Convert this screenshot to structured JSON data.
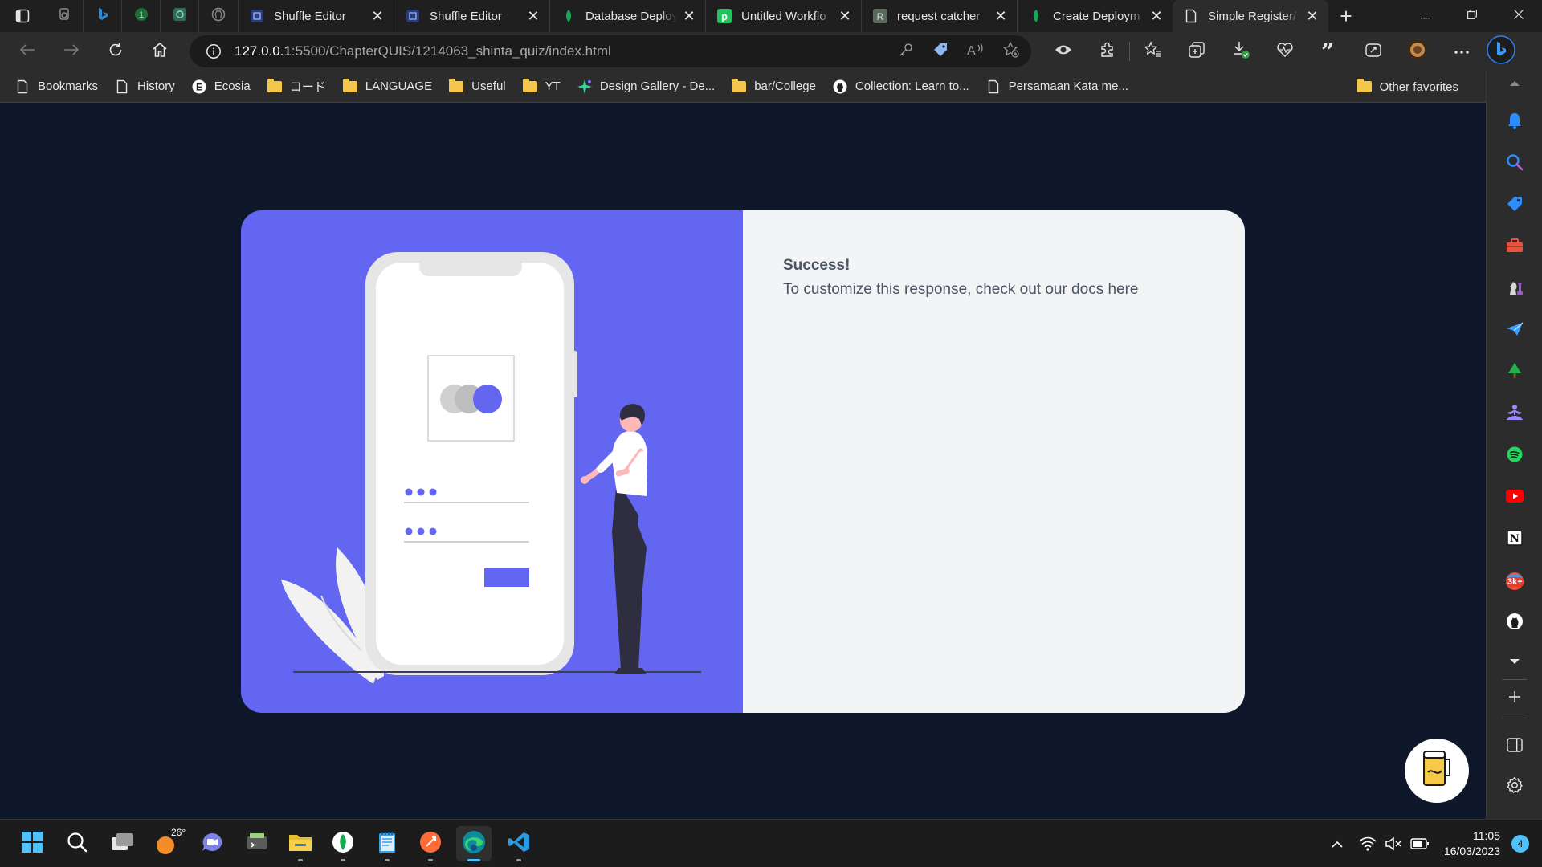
{
  "browser": {
    "tabs": [
      {
        "title": "Shuffle Editor",
        "icon": "shuffle-icon"
      },
      {
        "title": "Shuffle Editor",
        "icon": "shuffle-icon"
      },
      {
        "title": "Database Deploy",
        "icon": "mongodb-leaf-icon"
      },
      {
        "title": "Untitled Workflo",
        "icon": "pipedream-icon"
      },
      {
        "title": "request catcher",
        "icon": "r-icon"
      },
      {
        "title": "Create Deploym",
        "icon": "mongodb-leaf-icon"
      },
      {
        "title": "Simple Register/",
        "icon": "page-icon",
        "active": true
      }
    ],
    "url": {
      "host": "127.0.0.1",
      "path": ":5500/ChapterQUIS/1214063_shinta_quiz/index.html"
    }
  },
  "bookmarks": {
    "items": [
      {
        "label": "Bookmarks",
        "icon": "bookmarks-icon"
      },
      {
        "label": "History",
        "icon": "page-icon"
      },
      {
        "label": "Ecosia",
        "icon": "ecosia-icon"
      },
      {
        "label": "コード",
        "icon": "folder-icon"
      },
      {
        "label": "LANGUAGE",
        "icon": "folder-icon"
      },
      {
        "label": "Useful",
        "icon": "folder-icon"
      },
      {
        "label": "YT",
        "icon": "folder-icon"
      },
      {
        "label": "Design Gallery - De...",
        "icon": "sparkle-icon"
      },
      {
        "label": "bar/College",
        "icon": "folder-icon"
      },
      {
        "label": "Collection: Learn to...",
        "icon": "github-icon"
      },
      {
        "label": "Persamaan Kata me...",
        "icon": "page-icon"
      }
    ],
    "other": "Other favorites"
  },
  "page": {
    "message_title": "Success!",
    "message_body": "To customize this response, check out our docs here"
  },
  "taskbar": {
    "weather": "26°",
    "time": "11:05",
    "date": "16/03/2023",
    "notifications": "4"
  },
  "sidebar": {
    "badge": "3k+"
  },
  "colors": {
    "page_bg": "#0f172a",
    "card_left": "#6366f1",
    "card_right": "#f3f4f6",
    "message_text": "#4b5563"
  }
}
